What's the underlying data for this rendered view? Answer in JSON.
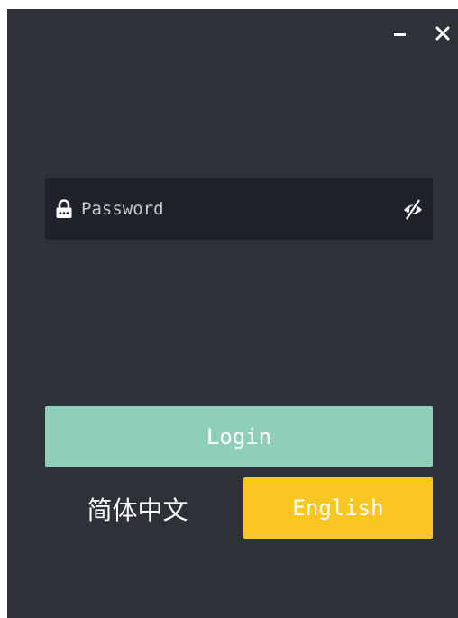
{
  "window": {
    "minimize_label": "–",
    "close_label": "✕"
  },
  "password": {
    "placeholder": "Password",
    "value": "",
    "lead_icon": "lock-icon",
    "toggle_icon": "eye-slash-icon"
  },
  "login": {
    "label": "Login"
  },
  "language": {
    "chinese_label": "简体中文",
    "english_label": "English",
    "selected": "English"
  },
  "colors": {
    "window_bg": "#2e3238",
    "input_bg": "#1f2329",
    "login_button": "#8fcfba",
    "selected_language": "#f9c623",
    "text": "#ffffff"
  }
}
